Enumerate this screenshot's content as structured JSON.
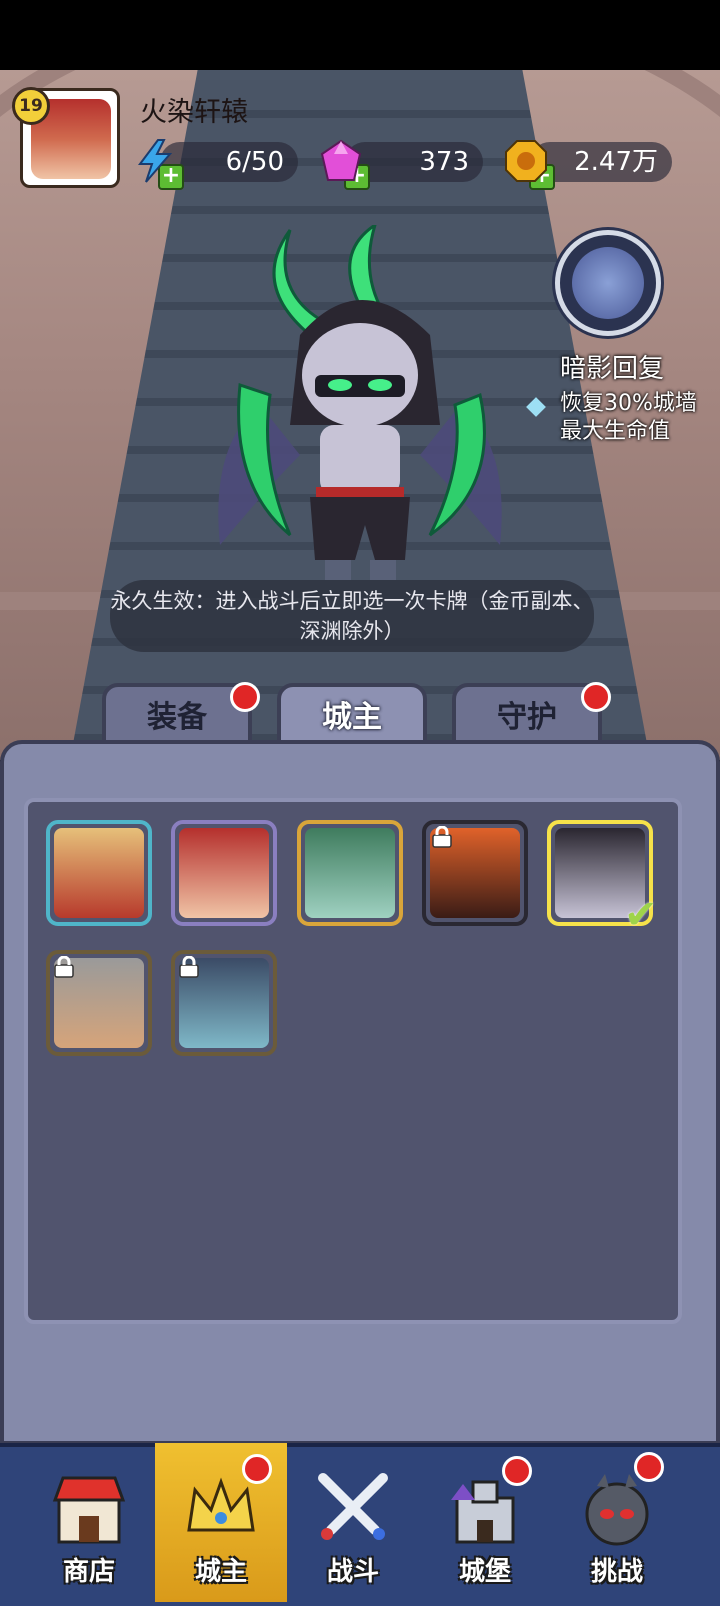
{
  "player": {
    "level": "19",
    "name": "火染轩辕"
  },
  "resources": {
    "energy": "6/50",
    "gems": "373",
    "gold": "2.47万"
  },
  "skill": {
    "name": "暗影回复",
    "description": "恢复30%城墙最大生命值"
  },
  "effect_text": "永久生效：进入战斗后立即选一次卡牌（金币副本、深渊除外）",
  "tabs": [
    {
      "label": "装备",
      "badge": true
    },
    {
      "label": "城主",
      "active": true
    },
    {
      "label": "守护",
      "badge": true
    }
  ],
  "lords": [
    {
      "name": "blonde-elf-lord",
      "locked": false,
      "selected": false,
      "frame": "#4fb5c9"
    },
    {
      "name": "red-hair-elf-lord",
      "locked": false,
      "selected": false,
      "frame": "#8a7fc0"
    },
    {
      "name": "green-elf-lord",
      "locked": false,
      "selected": false,
      "frame": "#d9a53a"
    },
    {
      "name": "fire-demon-lord",
      "locked": true,
      "selected": false,
      "frame": "#4a3a2a"
    },
    {
      "name": "illidan-lord",
      "locked": false,
      "selected": true,
      "frame": "#f6e24a"
    },
    {
      "name": "old-warrior-lord",
      "locked": true,
      "selected": false,
      "frame": "#6b5b3a"
    },
    {
      "name": "lich-king-lord",
      "locked": true,
      "selected": false,
      "frame": "#6b5b3a"
    }
  ],
  "nav": [
    {
      "label": "商店",
      "badge": false,
      "active": false
    },
    {
      "label": "城主",
      "badge": true,
      "active": true
    },
    {
      "label": "战斗",
      "badge": false,
      "active": false
    },
    {
      "label": "城堡",
      "badge": true,
      "active": false
    },
    {
      "label": "挑战",
      "badge": true,
      "active": false
    }
  ],
  "colors": {
    "panel": "#858aaa",
    "panel_inner": "#51546e",
    "nav_bg": "#2f4479",
    "nav_active": "#f0c030",
    "badge_red": "#e02626"
  }
}
